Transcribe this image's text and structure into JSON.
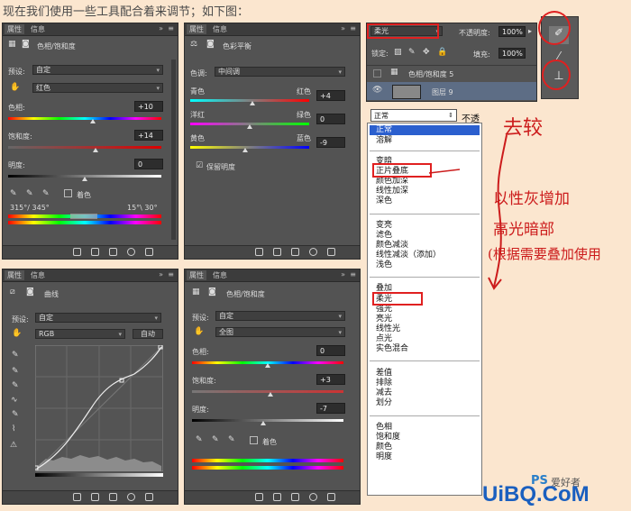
{
  "caption": "现在我们使用一些工具配合着来调节；如下图：",
  "p1": {
    "tab1": "属性",
    "tab2": "信息",
    "title": "色相/饱和度",
    "preset_label": "预设:",
    "preset": "自定",
    "channel": "红色",
    "hue_label": "色相:",
    "hue": "+10",
    "sat_label": "饱和度:",
    "sat": "+14",
    "light_label": "明度:",
    "light": "0",
    "colorize": "着色",
    "range_left": "315°/ 345°",
    "range_right": "15°\\ 30°"
  },
  "p2": {
    "tab1": "属性",
    "tab2": "信息",
    "title": "色彩平衡",
    "tone_label": "色调:",
    "tone": "中间调",
    "cyan": "青色",
    "red": "红色",
    "v1": "+4",
    "magenta": "洋红",
    "green": "绿色",
    "v2": "0",
    "yellow": "黄色",
    "blue": "蓝色",
    "v3": "-9",
    "preserve": "保留明度"
  },
  "p3": {
    "tab1": "属性",
    "tab2": "信息",
    "title": "曲线",
    "preset_label": "预设:",
    "preset": "自定",
    "channel": "RGB",
    "auto": "自动"
  },
  "p4": {
    "tab1": "属性",
    "tab2": "信息",
    "title": "色相/饱和度",
    "preset_label": "预设:",
    "preset": "自定",
    "channel": "全图",
    "hue_label": "色相:",
    "hue": "0",
    "sat_label": "饱和度:",
    "sat": "+3",
    "light_label": "明度:",
    "light": "-7",
    "colorize": "着色"
  },
  "layers": {
    "blend": "柔光",
    "opacity_label": "不透明度:",
    "opacity": "100%",
    "lock_label": "锁定:",
    "fill_label": "填充:",
    "fill": "100%",
    "layer1": "色相/饱和度 5",
    "layer2": "图层 9"
  },
  "blend_menu": {
    "current": "正常",
    "opacity_label": "不透",
    "items": [
      "正常",
      "溶解",
      "变暗",
      "正片叠底",
      "颜色加深",
      "线性加深",
      "深色",
      "变亮",
      "滤色",
      "颜色减淡",
      "线性减淡（添加）",
      "浅色",
      "叠加",
      "柔光",
      "强光",
      "亮光",
      "线性光",
      "点光",
      "实色混合",
      "差值",
      "排除",
      "减去",
      "划分",
      "色相",
      "饱和度",
      "颜色",
      "明度"
    ]
  },
  "annotations": {
    "a1": "去较",
    "a2": "以性灰增加",
    "a3": "高光暗部",
    "a4": "(根据需要叠加使用"
  },
  "watermark": {
    "ps": "PS",
    "site": "爱好者",
    "brand": "UiBQ.CoM"
  },
  "colors": {
    "accent_red": "#e02020",
    "panel_bg": "#535353"
  }
}
